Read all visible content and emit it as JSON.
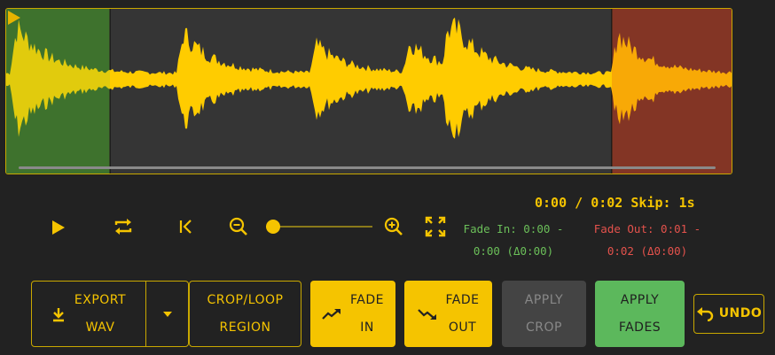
{
  "timeline": {
    "current": "0:00",
    "total": "0:02",
    "skip_label": "Skip: 1s"
  },
  "fade_in": {
    "label": "Fade In: 0:00 -",
    "end": "0:00 (Δ0:00)"
  },
  "fade_out": {
    "label": "Fade Out: 0:01 -",
    "end": "0:02 (Δ0:00)"
  },
  "zoom": {
    "level": 0
  },
  "buttons": {
    "export_line1": "EXPORT",
    "export_line2": "WAV",
    "crop_line1": "CROP/LOOP",
    "crop_line2": "REGION",
    "fade_in_line1": "FADE",
    "fade_in_line2": "IN",
    "fade_out_line1": "FADE",
    "fade_out_line2": "OUT",
    "apply_crop_line1": "APPLY",
    "apply_crop_line2": "CROP",
    "apply_fades_line1": "APPLY",
    "apply_fades_line2": "FADES",
    "undo": "UNDO"
  },
  "colors": {
    "accent": "#f5c400",
    "fade_in_region": "#2f5a2a",
    "fade_out_region": "#5e2b2b",
    "waveform": "#ffcc00",
    "apply_fades_bg": "#5cb85c"
  }
}
